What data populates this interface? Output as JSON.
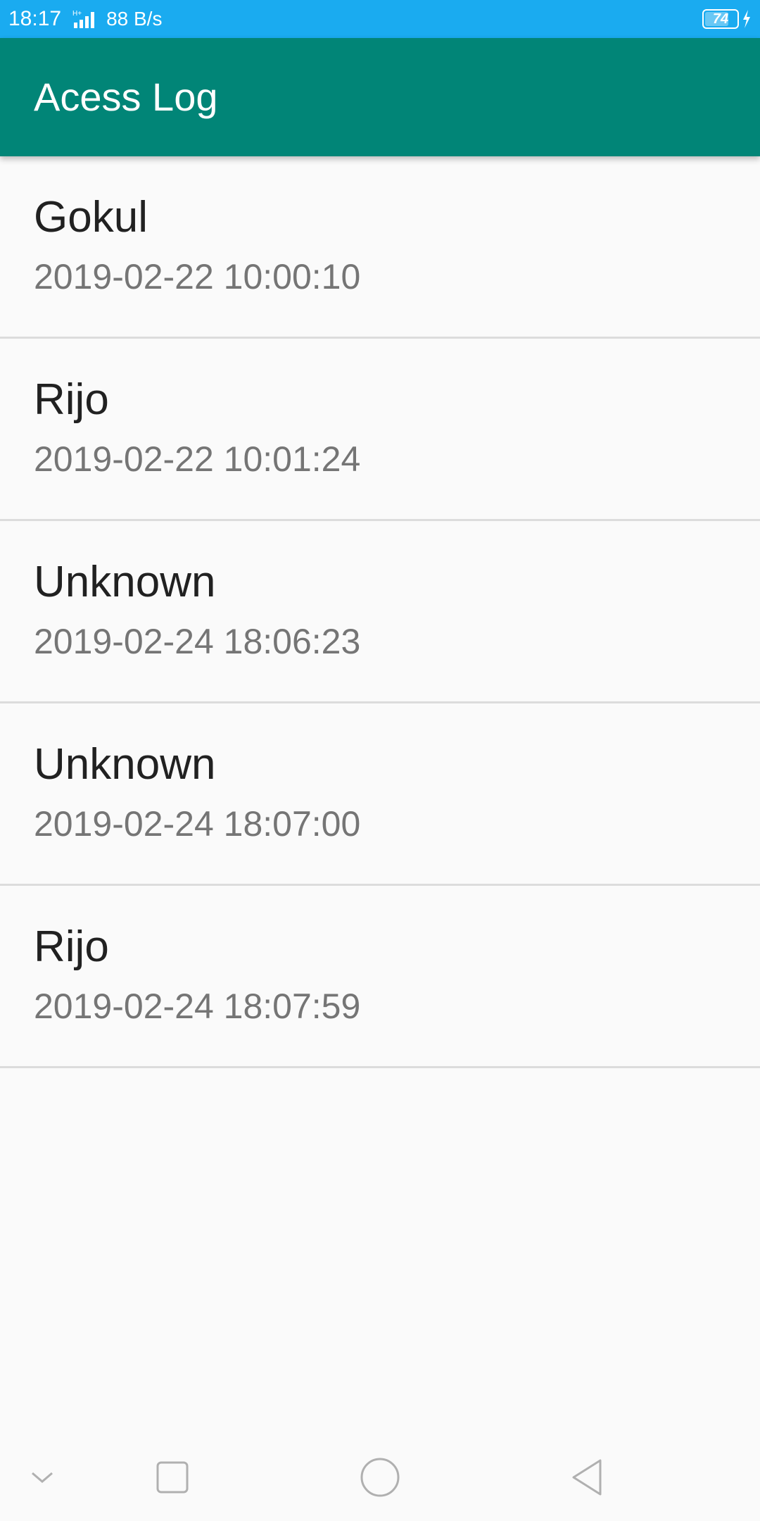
{
  "status_bar": {
    "time": "18:17",
    "network_type": "H+",
    "net_speed": "88 B/s",
    "battery_level": "74",
    "battery_fraction": 0.74,
    "charging": true,
    "color": "#1aabf0"
  },
  "app_bar": {
    "title": "Acess Log",
    "color": "#018577"
  },
  "log_entries": [
    {
      "name": "Gokul",
      "timestamp": "2019-02-22 10:00:10"
    },
    {
      "name": "Rijo",
      "timestamp": "2019-02-22 10:01:24"
    },
    {
      "name": "Unknown",
      "timestamp": "2019-02-24 18:06:23"
    },
    {
      "name": "Unknown",
      "timestamp": "2019-02-24 18:07:00"
    },
    {
      "name": "Rijo",
      "timestamp": "2019-02-24 18:07:59"
    }
  ],
  "nav_bar": {
    "buttons": [
      "chevron-down-icon",
      "recents-square-icon",
      "home-circle-icon",
      "back-triangle-icon"
    ]
  }
}
